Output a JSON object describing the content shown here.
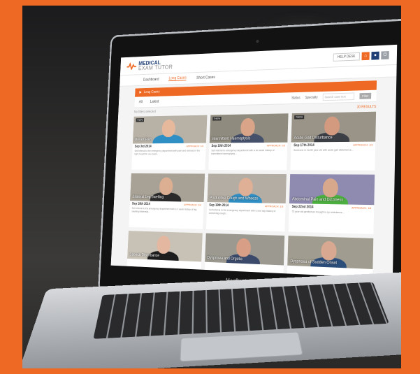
{
  "app": {
    "logo_line1": "MEDICAL",
    "logo_line2": "EXAM TUTOR",
    "help_label": "HELP DESK",
    "brand_color": "#ee6a24",
    "navy": "#1f3f75"
  },
  "nav": [
    "Dashboard",
    "Long Cases",
    "Short Cases"
  ],
  "banner": {
    "icon": "video-icon",
    "label": "Long Cases"
  },
  "filters": {
    "tab_all": "All",
    "tab_latest": "Latest",
    "status": "Status",
    "specialty": "Specialty",
    "search_placeholder": "Search case text",
    "filter_btn": "Filter"
  },
  "meta": {
    "left": "No filters selected",
    "right": "30 RESULTS"
  },
  "device_label": "MacBook Air",
  "cards": [
    {
      "title": "Breast Pain",
      "tag": "THEFA",
      "date": "Sep 3rd 2014",
      "approach": "APPROACH: 1/4",
      "desc": "Self referral to the emergency department with pain and redness in the right breast for one week...",
      "skin": "#e6b99d",
      "shirt": "#2f8fc4",
      "bg": "#b7b1a6"
    },
    {
      "title": "Intermittent Haemoptysis",
      "tag": "THEFA",
      "date": "Sep 10th 2014",
      "approach": "APPROACH: 1/3",
      "desc": "Self referral to emergency department with a six week history of intermittent haemoptysis...",
      "skin": "#d9a487",
      "shirt": "#45506b",
      "bg": "#8f8b7e"
    },
    {
      "title": "Acute Gait Disturbance",
      "tag": "THEFA",
      "date": "Sep 17th 2014",
      "approach": "APPROACH: 1/3",
      "desc": "Someone in his 60 year old with acute gait disturbance...",
      "skin": "#d49a80",
      "shirt": "#3d3f47",
      "bg": "#9a9488"
    },
    {
      "title": "Bilateral Leg Swelling",
      "tag": "",
      "date": "Sep 18th 2014",
      "approach": "APPROACH: 1/4",
      "desc": "Self referral to the emergency department with a 2 week history of leg swelling bilaterally...",
      "skin": "#dcae92",
      "shirt": "#2a2a2a",
      "bg": "#a8a296"
    },
    {
      "title": "Productive Cough and Wheeze",
      "tag": "",
      "date": "Sep 19th 2014",
      "approach": "APPROACH: 1/3",
      "desc": "Self referral to the emergency department with a one day history of worsening cough...",
      "skin": "#e0b096",
      "shirt": "#2f8fc4",
      "bg": "#b3ada3"
    },
    {
      "title": "Abdominal Pain and Dizziness",
      "tag": "",
      "date": "Sep 22nd 2014",
      "approach": "APPROACH: 1/4",
      "desc": "75 year old gentleman brought in by ambulance...",
      "skin": "#d8a88d",
      "shirt": "#4caf3f",
      "bg": "#8e8ab0"
    },
    {
      "title": "Speech Disturbance",
      "tag": "",
      "date": "",
      "approach": "",
      "desc": "",
      "skin": "#e4b8a0",
      "shirt": "#1d1d1d",
      "bg": "#c8c2b6"
    },
    {
      "title": "Dyspnoea and Orgotia",
      "tag": "",
      "date": "",
      "approach": "",
      "desc": "",
      "skin": "#d99f86",
      "shirt": "#3b4a6b",
      "bg": "#9c9a90"
    },
    {
      "title": "Dyspnoea of Sudden Onset",
      "tag": "",
      "date": "",
      "approach": "",
      "desc": "",
      "skin": "#d8a990",
      "shirt": "#2b4d7a",
      "bg": "#a09c8f"
    }
  ]
}
